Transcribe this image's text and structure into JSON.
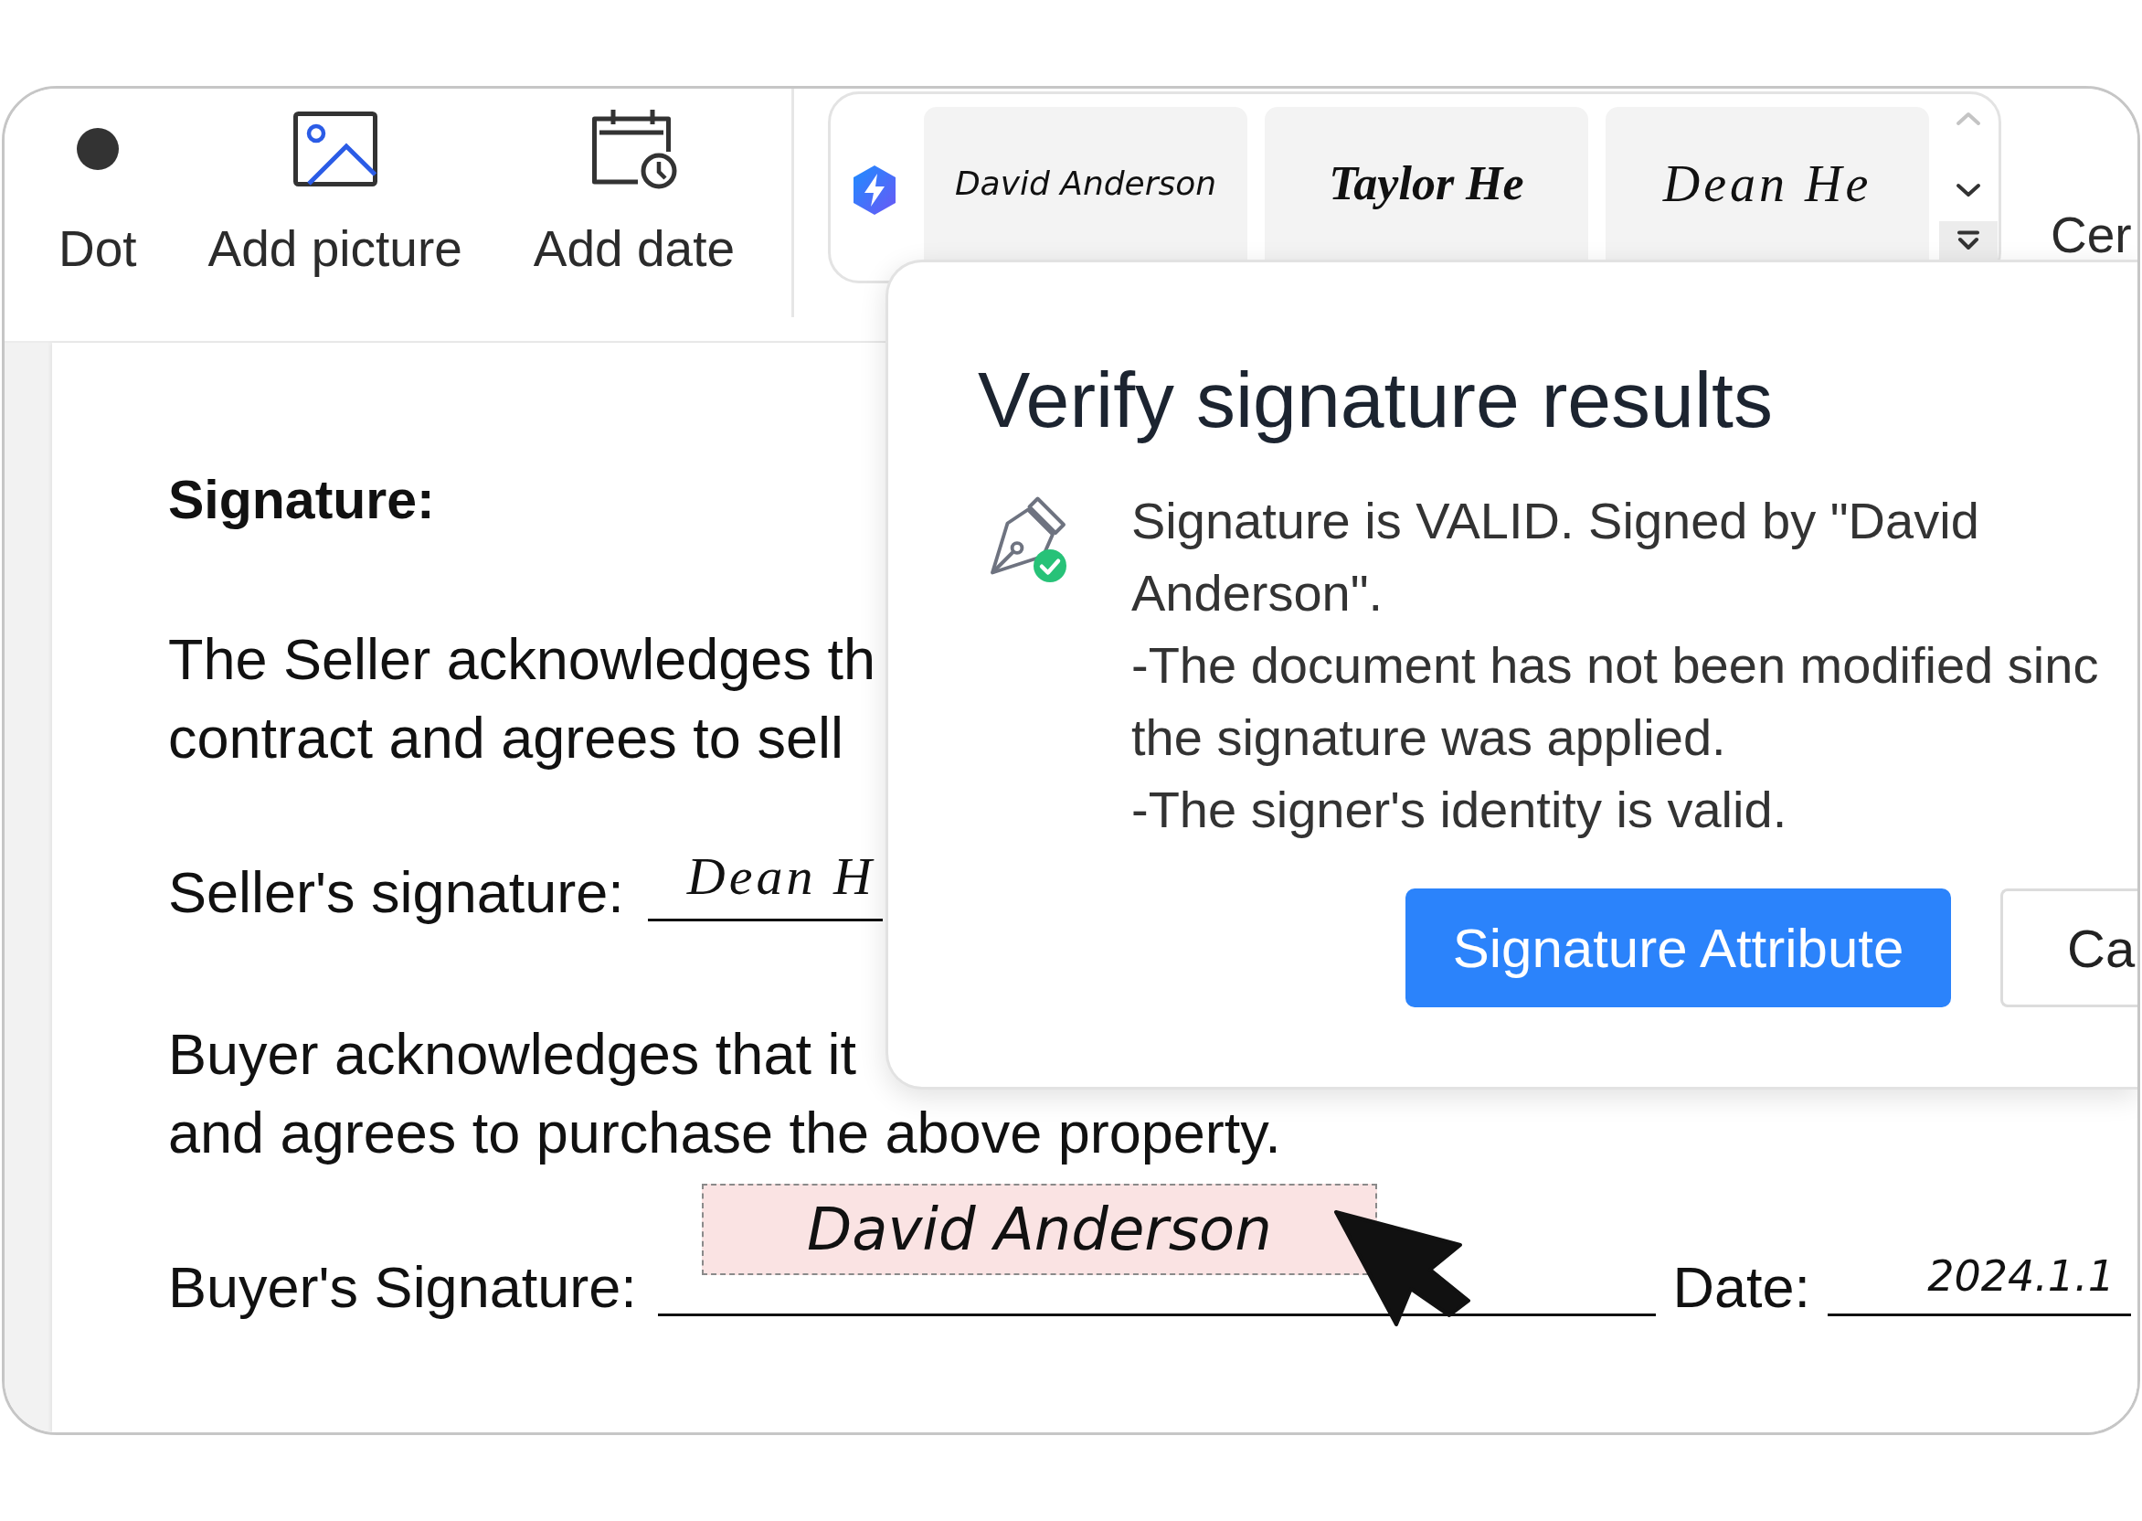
{
  "toolbar": {
    "tools": [
      {
        "kind": "dot",
        "label": "Dot"
      },
      {
        "kind": "picture",
        "label": "Add picture"
      },
      {
        "kind": "date",
        "label": "Add date"
      }
    ],
    "signatures": [
      {
        "name": "David Anderson"
      },
      {
        "name": "Taylor He"
      },
      {
        "name": "Dean He"
      }
    ],
    "scroll_buttons": [
      {
        "kind": "up",
        "disabled": true
      },
      {
        "kind": "down",
        "disabled": false
      },
      {
        "kind": "expand",
        "disabled": false
      }
    ],
    "more_tool": {
      "label": "Cer"
    }
  },
  "document": {
    "blocks": [
      {
        "kind": "heading",
        "text": "Signature:"
      },
      {
        "kind": "paragraph",
        "lines": [
          "The Seller acknowledges th",
          "contract and agrees to sell"
        ]
      },
      {
        "kind": "signature_row",
        "fields": [
          {
            "kind": "text",
            "label": "Seller's signature:",
            "value": "Dean H"
          }
        ]
      },
      {
        "kind": "paragraph",
        "lines": [
          "Buyer acknowledges that it",
          "and agrees to purchase the above property."
        ]
      },
      {
        "kind": "signature_row",
        "fields": [
          {
            "kind": "stamp",
            "label": "Buyer's Signature:",
            "value": "David Anderson"
          },
          {
            "kind": "text",
            "label": "Date:",
            "value": "2024.1.1"
          }
        ]
      }
    ]
  },
  "dialog": {
    "title": "Verify signature results",
    "message": [
      {
        "lines": [
          "Signature is VALID. Signed by \"David",
          "Anderson\"."
        ]
      },
      {
        "lines": [
          "-The document has not been modified sinc",
          "the signature was applied."
        ]
      },
      {
        "lines": [
          "-The signer's identity is valid."
        ]
      }
    ],
    "buttons": [
      {
        "kind": "primary",
        "label": "Signature Attribute"
      },
      {
        "kind": "secondary",
        "label": "Ca"
      }
    ]
  }
}
